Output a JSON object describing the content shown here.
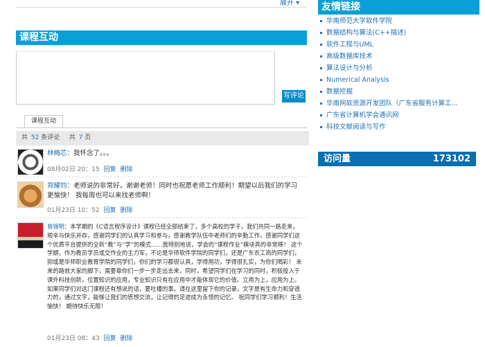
{
  "top": {
    "more_label": "展开 ▾"
  },
  "interaction": {
    "title": "课程互动",
    "submit_label": "写评论",
    "tab_label": "课程互动",
    "stats": {
      "prefix": "共",
      "users": "52",
      "users_label": "条评论",
      "sep": "共",
      "pages": "7",
      "pages_label": "页"
    }
  },
  "comments": [
    {
      "name": "林梅芯",
      "text": "我怀念了。。。",
      "date": "08月02日",
      "time": "20：15",
      "reply": "回复",
      "delete": "删除"
    },
    {
      "name": "郑耀钧",
      "text": "老师说的非常好，谢谢老师！同时也祝愿老师工作顺利！期望以后我们的学习更愉快！ 我每周也可以来找老师啊！",
      "date": "01月23日",
      "time": "10：52",
      "reply": "回复",
      "delete": "删除"
    },
    {
      "name": "曾锦明",
      "text": "本学期的《C语言程序设计》课程已经全部结束了，多个高校的学子，我们共同一路走来，艰辛与快乐并存，感谢同学们的认真学习和参与，感谢教学队伍中老师们的辛勤工作，感谢同学们这个优质平台提供的全新“教”与“学”的模式……我特别地说，学会的“课程作业”模块真的非常棒！ 这个学期，作为教员学员或交作业的主力军，不论是华师软件学院的同学们，还是广东农工商的同学们，抑或是华师职业教育学院的同学们，你们的学习都很认真，学得用功，学得很扎实，为你们喝彩！ 未来的路就大家的脚下，需要靠你们一步一步走出去来，同时，希望同学们在学习的同时，积极投入于课外科技创新，位置知识的应用，专业知识只有在应用中才能体现它的价值。立用为上，应用为上。如果同学们对这门课程还有想说的话，要吐槽的事，请在这里留下你的记录，文字是有生命力和穿透力的，通过文字，能够让我们的思想交流，让记得的足迹成为永恒的记忆。 祝同学们学习顺利！生活愉快！ 期待快乐无限！",
      "date": "01月23日",
      "time": "08：43",
      "reply": "回复",
      "delete": "删除"
    }
  ],
  "friend_links": {
    "title": "友情链接",
    "items": [
      "华南师范大学软件学院",
      "数据结构与算法(C++描述)",
      "软件工程与UML",
      "高级数据库技术",
      "算法设计与分析",
      "Numerical Analysis",
      "数据挖掘",
      "华南网软资源开发团队（广东省服务计算工...",
      "广东省计算机学会通讯网",
      "科技文献阅读与写作"
    ]
  },
  "visits": {
    "label": "访问量",
    "count": "173102"
  }
}
